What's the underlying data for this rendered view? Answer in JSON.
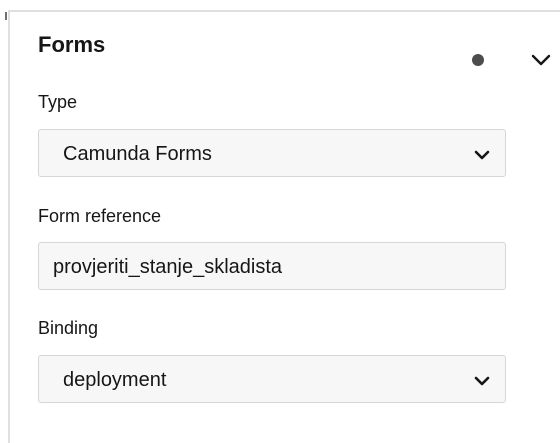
{
  "group": {
    "title": "Forms",
    "status_icon": "dot-icon",
    "toggle_icon": "chevron-down-icon"
  },
  "fields": {
    "type": {
      "label": "Type",
      "value": "Camunda Forms"
    },
    "form_reference": {
      "label": "Form reference",
      "value": "provjeriti_stanje_skladista"
    },
    "binding": {
      "label": "Binding",
      "value": "deployment"
    }
  },
  "colors": {
    "field_bg": "#f7f7f8",
    "field_border": "#d6d6d6",
    "text": "#161616",
    "dot": "#4d4d4d"
  }
}
